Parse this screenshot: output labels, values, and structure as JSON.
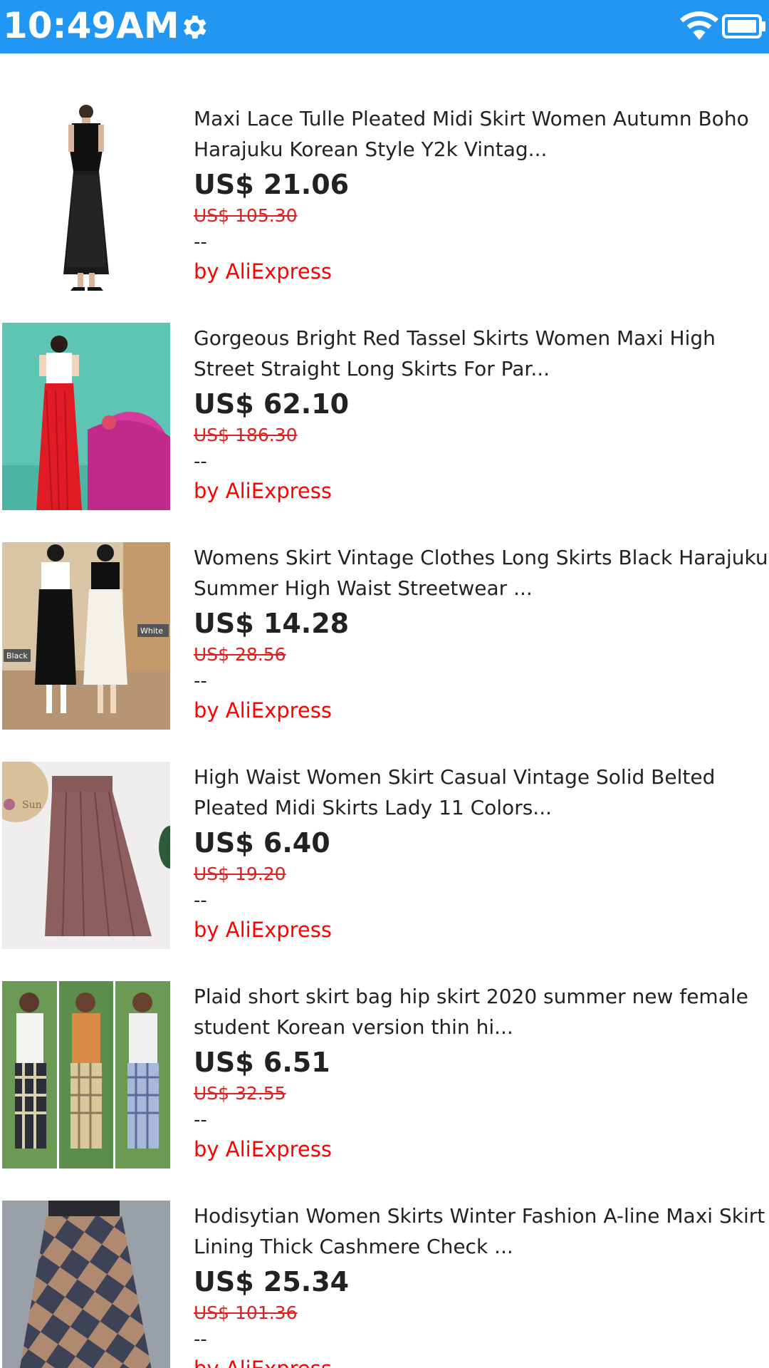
{
  "status_bar": {
    "time": "10:49AM",
    "color": "#2196f3",
    "icons": [
      "gear-icon",
      "wifi-icon",
      "battery-icon"
    ]
  },
  "products": [
    {
      "title": "Maxi Lace Tulle Pleated Midi Skirt Women Autumn Boho Harajuku Korean Style Y2k Vintag...",
      "price": "US$ 21.06",
      "original_price": "US$ 105.30",
      "rating": "--",
      "seller": "by AliExpress"
    },
    {
      "title": "Gorgeous Bright Red Tassel Skirts Women Maxi High Street Straight Long Skirts For Par...",
      "price": "US$ 62.10",
      "original_price": "US$ 186.30",
      "rating": "--",
      "seller": "by AliExpress"
    },
    {
      "title": "Womens Skirt Vintage Clothes Long Skirts Black Harajuku Summer High Waist Streetwear ...",
      "price": "US$ 14.28",
      "original_price": "US$ 28.56",
      "rating": "--",
      "seller": "by AliExpress"
    },
    {
      "title": "High Waist Women Skirt Casual Vintage Solid Belted Pleated Midi Skirts Lady 11 Colors...",
      "price": "US$ 6.40",
      "original_price": "US$ 19.20",
      "rating": "--",
      "seller": "by AliExpress"
    },
    {
      "title": "Plaid short skirt bag hip skirt 2020 summer new female student Korean version thin hi...",
      "price": "US$ 6.51",
      "original_price": "US$ 32.55",
      "rating": "--",
      "seller": "by AliExpress"
    },
    {
      "title": "Hodisytian Women Skirts Winter Fashion A-line Maxi Skirt Lining Thick Cashmere Check ...",
      "price": "US$ 25.34",
      "original_price": "US$ 101.36",
      "rating": "--",
      "seller": "by AliExpress"
    }
  ],
  "thumb_labels": {
    "black": "Black",
    "white": "White",
    "sun": "Sun"
  }
}
